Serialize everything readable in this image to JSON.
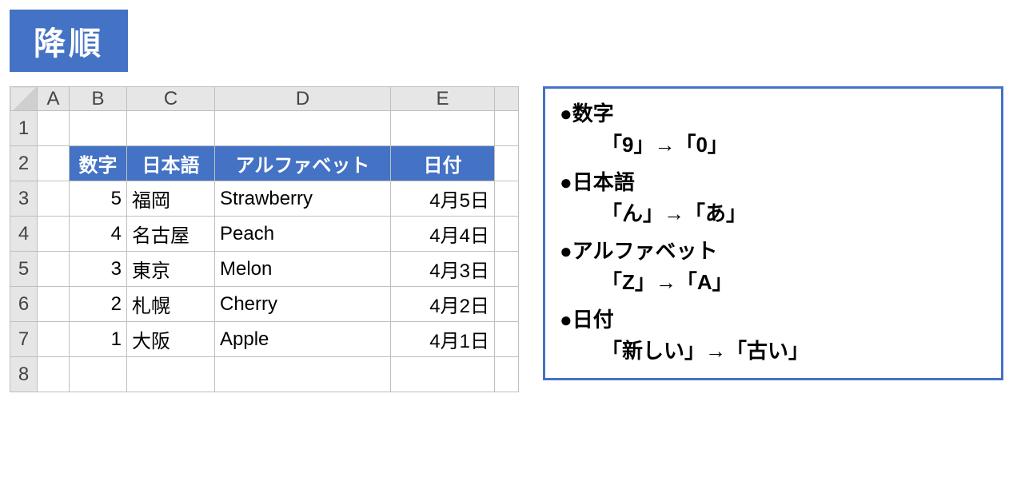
{
  "title": "降順",
  "sheet": {
    "columns": [
      "A",
      "B",
      "C",
      "D",
      "E",
      ""
    ],
    "row_numbers": [
      "1",
      "2",
      "3",
      "4",
      "5",
      "6",
      "7",
      "8"
    ],
    "headers": {
      "num": "数字",
      "jp": "日本語",
      "alpha": "アルファベット",
      "date": "日付"
    },
    "rows": [
      {
        "num": "5",
        "jp": "福岡",
        "alpha": "Strawberry",
        "date": "4月5日"
      },
      {
        "num": "4",
        "jp": "名古屋",
        "alpha": "Peach",
        "date": "4月4日"
      },
      {
        "num": "3",
        "jp": "東京",
        "alpha": "Melon",
        "date": "4月3日"
      },
      {
        "num": "2",
        "jp": "札幌",
        "alpha": "Cherry",
        "date": "4月2日"
      },
      {
        "num": "1",
        "jp": "大阪",
        "alpha": "Apple",
        "date": "4月1日"
      }
    ]
  },
  "legend": {
    "items": [
      {
        "label": "●数字",
        "rule": "「9」→「0」"
      },
      {
        "label": "●日本語",
        "rule": "「ん」→「あ」"
      },
      {
        "label": "●アルファベット",
        "rule": "「Z」→「A」"
      },
      {
        "label": "●日付",
        "rule": "「新しい」→「古い」"
      }
    ]
  }
}
